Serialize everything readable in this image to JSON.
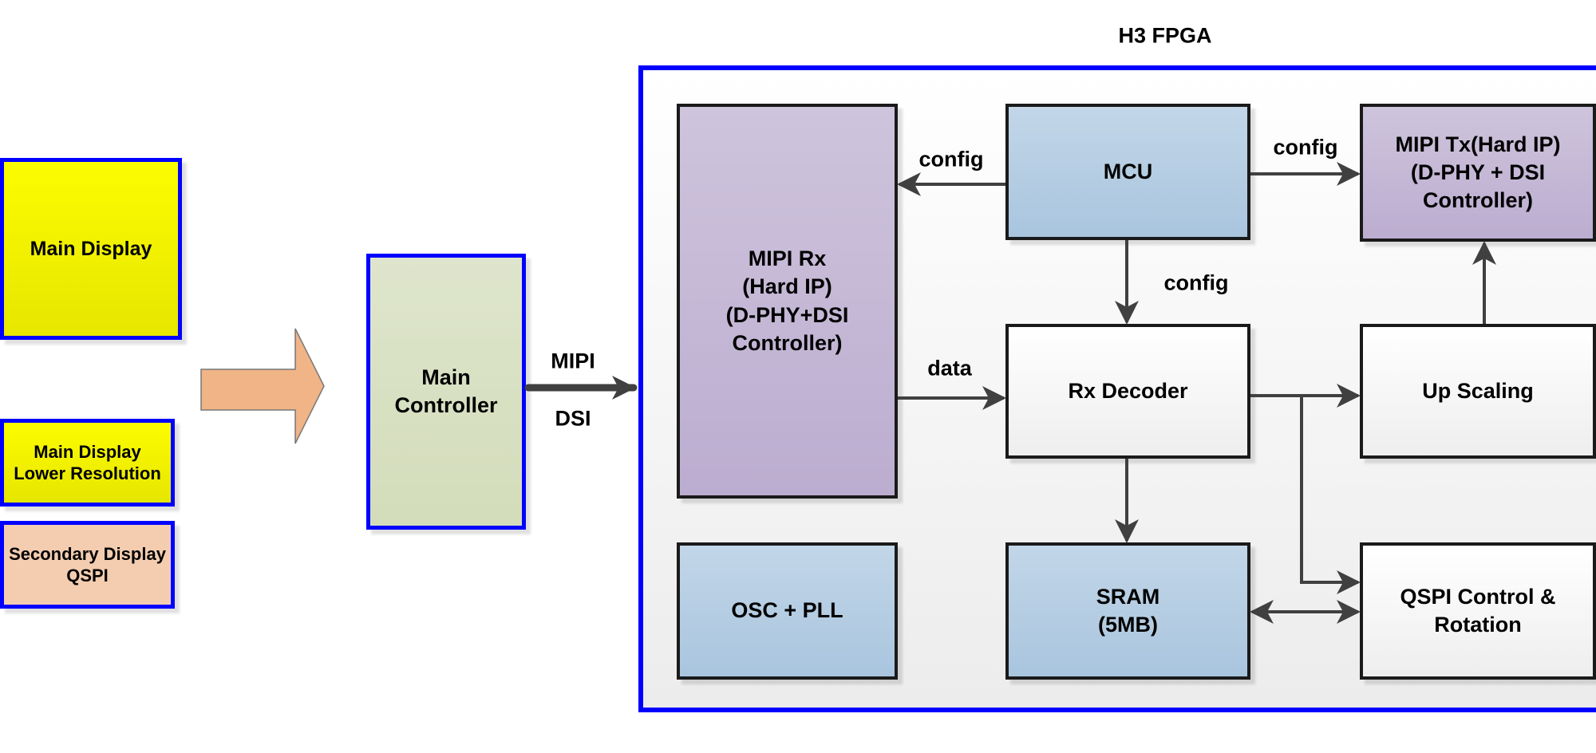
{
  "fpga": {
    "title": "H3 FPGA"
  },
  "displays": {
    "main": "Main Display",
    "main_lower": "Main Display\nLower Resolution",
    "secondary": "Secondary Display\nQSPI"
  },
  "main_controller": "Main\nController",
  "link": {
    "line1": "MIPI",
    "line2": "DSI"
  },
  "blocks": {
    "mipi_rx": "MIPI Rx\n(Hard IP)\n(D-PHY+DSI\nController)",
    "mcu": "MCU",
    "mipi_tx": "MIPI Tx(Hard IP)\n(D-PHY + DSI\nController)",
    "rx_decoder": "Rx Decoder",
    "up_scaling": "Up Scaling",
    "osc_pll": "OSC + PLL",
    "sram": "SRAM\n(5MB)",
    "qspi": "QSPI Control &\nRotation"
  },
  "edge_labels": {
    "config_rx": "config",
    "config_tx": "config",
    "config_dec": "config",
    "data": "data"
  },
  "colors": {
    "border_blue": "#0000ff",
    "arrow": "#404040",
    "big_arrow": "#f0b487"
  }
}
